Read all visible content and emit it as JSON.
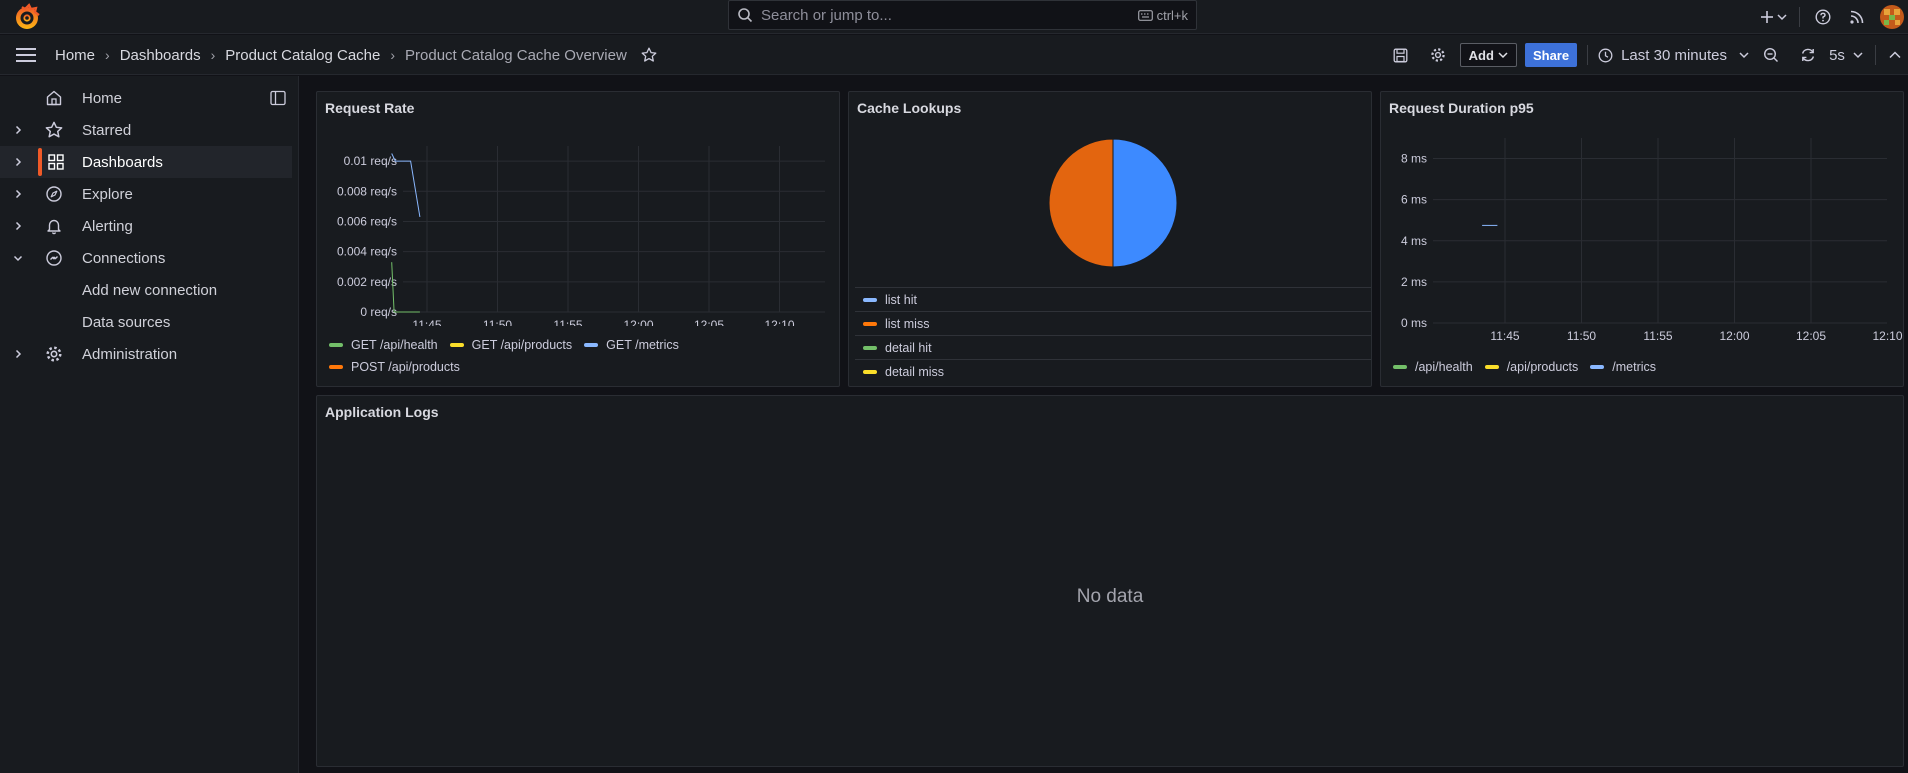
{
  "search": {
    "placeholder": "Search or jump to...",
    "shortcut": "ctrl+k"
  },
  "breadcrumb": [
    "Home",
    "Dashboards",
    "Product Catalog Cache",
    "Product Catalog Cache Overview"
  ],
  "actions": {
    "add_label": "Add",
    "share_label": "Share",
    "time_range": "Last 30 minutes",
    "refresh_interval": "5s"
  },
  "sidebar": {
    "items": [
      {
        "label": "Home",
        "icon": "home-icon",
        "expandable": false
      },
      {
        "label": "Starred",
        "icon": "star-icon",
        "expandable": true
      },
      {
        "label": "Dashboards",
        "icon": "grid-icon",
        "expandable": true,
        "active": true
      },
      {
        "label": "Explore",
        "icon": "compass-icon",
        "expandable": true
      },
      {
        "label": "Alerting",
        "icon": "bell-icon",
        "expandable": true
      },
      {
        "label": "Connections",
        "icon": "connections-icon",
        "expandable": true,
        "expanded": true
      },
      {
        "label": "Add new connection",
        "child": true
      },
      {
        "label": "Data sources",
        "child": true
      },
      {
        "label": "Administration",
        "icon": "gear-icon",
        "expandable": true
      }
    ]
  },
  "colors": {
    "green": "#73bf69",
    "yellow": "#fade2a",
    "blue": "#8ab8ff",
    "orange": "#ff780a",
    "accent": "#f05a28",
    "pie_blue": "#3d8aff",
    "pie_orange": "#e3650f"
  },
  "panels": {
    "request_rate": {
      "title": "Request Rate"
    },
    "cache_lookups": {
      "title": "Cache Lookups"
    },
    "duration": {
      "title": "Request Duration p95"
    },
    "logs": {
      "title": "Application Logs",
      "empty_text": "No data"
    }
  },
  "chart_data": [
    {
      "type": "line",
      "title": "Request Rate",
      "x_ticks": [
        "11:45",
        "11:50",
        "11:55",
        "12:00",
        "12:05",
        "12:10"
      ],
      "y_ticks": [
        "0 req/s",
        "0.002 req/s",
        "0.004 req/s",
        "0.006 req/s",
        "0.008 req/s",
        "0.01 req/s"
      ],
      "ylim": [
        0,
        0.011
      ],
      "series": [
        {
          "name": "GET /api/health",
          "color": "#73bf69",
          "points": [
            [
              "11:42:30",
              0.0033
            ],
            [
              "11:42:40",
              0
            ],
            [
              "11:44:30",
              0
            ]
          ]
        },
        {
          "name": "GET /api/products",
          "color": "#fade2a",
          "points": []
        },
        {
          "name": "GET /metrics",
          "color": "#8ab8ff",
          "points": [
            [
              "11:42:30",
              0.0105
            ],
            [
              "11:42:45",
              0.01
            ],
            [
              "11:43:50",
              0.01
            ],
            [
              "11:44:30",
              0.0063
            ]
          ]
        },
        {
          "name": "POST /api/products",
          "color": "#ff780a",
          "points": []
        }
      ],
      "grid": true,
      "legend": "bottom"
    },
    {
      "type": "pie",
      "title": "Cache Lookups",
      "slices": [
        {
          "name": "list hit",
          "value": 50,
          "color": "#3d8aff"
        },
        {
          "name": "list miss",
          "value": 50,
          "color": "#e3650f"
        },
        {
          "name": "detail hit",
          "value": 0,
          "color": "#73bf69"
        },
        {
          "name": "detail miss",
          "value": 0,
          "color": "#fade2a"
        }
      ],
      "legend_swatches": [
        "#8ab8ff",
        "#ff780a",
        "#73bf69",
        "#fade2a"
      ],
      "legend": "bottom"
    },
    {
      "type": "line",
      "title": "Request Duration p95",
      "x_ticks": [
        "11:45",
        "11:50",
        "11:55",
        "12:00",
        "12:05",
        "12:10"
      ],
      "y_ticks": [
        "0 ms",
        "2 ms",
        "4 ms",
        "6 ms",
        "8 ms"
      ],
      "ylim": [
        0,
        9
      ],
      "series": [
        {
          "name": "/api/health",
          "color": "#73bf69",
          "points": []
        },
        {
          "name": "/api/products",
          "color": "#fade2a",
          "points": []
        },
        {
          "name": "/metrics",
          "color": "#8ab8ff",
          "points": [
            [
              "11:43:30",
              4.75
            ],
            [
              "11:44:30",
              4.75
            ]
          ]
        }
      ],
      "grid": true,
      "legend": "bottom"
    }
  ]
}
